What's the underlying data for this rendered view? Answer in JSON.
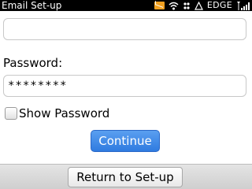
{
  "status_bar": {
    "title": "Email Set-up",
    "network": "EDGE",
    "icons": [
      "message-icon",
      "wifi-icon",
      "bluetooth-icon",
      "alert-icon",
      "signal-icon"
    ]
  },
  "form": {
    "email_value": "",
    "password_label": "Password:",
    "password_value": "********",
    "show_password_label": "Show Password",
    "show_password_checked": false,
    "continue_label": "Continue"
  },
  "bottom_bar": {
    "return_label": "Return to Set-up"
  },
  "colors": {
    "status_bg": "#000000",
    "accent_button": "#3f8ae6",
    "message_icon": "#f0a020"
  }
}
